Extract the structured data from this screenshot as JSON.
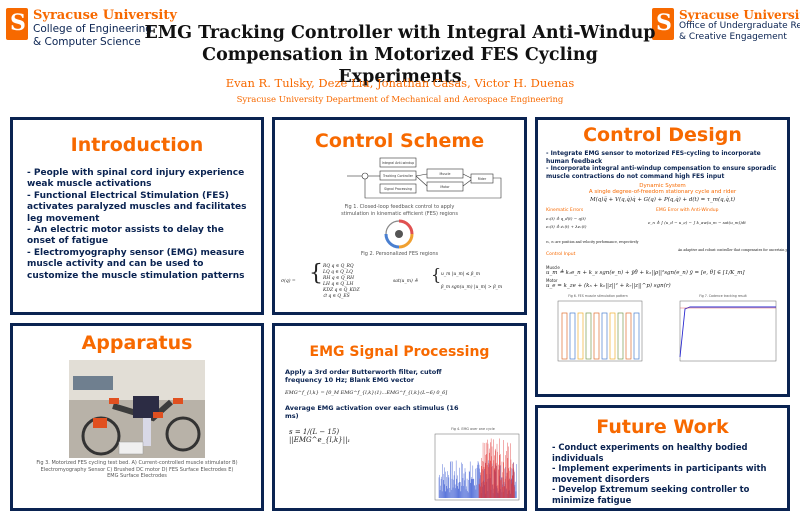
{
  "header": {
    "logo_left": {
      "line1": "Syracuse University",
      "line2": "College of Engineering",
      "line3": "& Computer Science"
    },
    "logo_right": {
      "line1": "Syracuse University",
      "line2": "Office of Undergraduate Research",
      "line3": "& Creative Engagement"
    },
    "title_line1": "EMG Tracking Controller with Integral Anti-Windup",
    "title_line2": "Compensation in Motorized FES Cycling Experiments",
    "authors": "Evan R. Tulsky, Deze Liu, Jonathan Casas, Victor H. Duenas",
    "affiliation": "Syracuse University Department of Mechanical and Aerospace Engineering"
  },
  "introduction": {
    "title": "Introduction",
    "bullets": [
      "- People with spinal cord injury experience weak muscle activations",
      "- Functional Electrical Stimulation (FES) activates paralyzed muscles and facilitates leg movement",
      "- An electric motor assists to delay the onset of fatigue",
      "- Electromyography sensor (EMG) measure muscle activity and can be used to customize the muscle stimulation patterns"
    ]
  },
  "control_scheme": {
    "title": "Control Scheme",
    "fig1_caption": "Fig 1. Closed-loop feedback control to apply stimulation in kinematic efficient (FES) regions",
    "fig2_caption": "Fig 2. Personalized FES regions",
    "blocks": [
      "Integral Anti-windup",
      "Tracking Controller",
      "Signal Processing",
      "Muscle",
      "Motor",
      "Rider"
    ]
  },
  "control_design": {
    "title": "Control Design",
    "bullets": [
      "- Integrate EMG sensor to motorized FES-cycling to incorporate human feedback",
      "- Incorporate integral anti-windup compensation to ensure sporadic muscle contractions do not command high FES input"
    ],
    "dynamic_system": "Dynamic System",
    "dynamic_desc": "A single degree-of-freedom stationary cycle and rider",
    "kinematic_errors": "Kinematic Errors",
    "emg_error": "EMG Error with Anti-Windup",
    "control_input": "Control Input",
    "muscle_label": "Muscle",
    "motor_label": "Motor",
    "fig6_caption": "Fig 6. FES muscle stimulation pattern",
    "fig7_caption": "Fig 7. Cadence tracking result"
  },
  "apparatus": {
    "title": "Apparatus",
    "caption": "Fig 3. Motorized FES cycling test bed. A) Current-controlled muscle stimulator B) Electromyography Sensor C) Brushed DC motor D) FES Surface Electrodes E) EMG Surface Electrodes"
  },
  "emg_processing": {
    "title": "EMG Signal Processing",
    "step1": "Apply a 3rd order Butterworth filter, cutoff frequency 10 Hz; Blank EMG vector",
    "step2": "Average EMG activation over each stimulus (16 ms)",
    "fig_caption": "Fig 4. EMG over one cycle"
  },
  "future_work": {
    "title": "Future Work",
    "bullets": [
      "- Conduct experiments on healthy bodied individuals",
      "- Implement experiments in participants with movement disorders",
      "- Develop Extremum seeking controller to minimize fatigue"
    ]
  },
  "colors": {
    "accent": "#f76900",
    "navy": "#0a2351"
  }
}
